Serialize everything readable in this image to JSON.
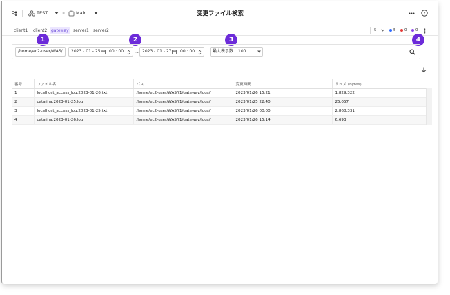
{
  "topbar": {
    "workspace": "TEST",
    "project": "Main",
    "title": "変更ファイル検索"
  },
  "tabs": [
    {
      "label": "client1",
      "active": false
    },
    {
      "label": "client2",
      "active": false
    },
    {
      "label": "gateway",
      "active": true
    },
    {
      "label": "server1",
      "active": false
    },
    {
      "label": "server2",
      "active": false
    }
  ],
  "status": {
    "count": "5",
    "blue": "5",
    "red": "0",
    "purple": "0",
    "colors": {
      "blue": "#2f6bff",
      "red": "#e53935",
      "purple": "#8e44ec"
    }
  },
  "filter": {
    "path": "/home/ec2-user/WAS/t",
    "from_date": "2023 - 01 - 25",
    "from_time": "00 : 00",
    "range_sep": "~",
    "to_date": "2023 - 01 - 27",
    "to_time": "00 : 00",
    "max_label": "最大表示数",
    "max_value": "100"
  },
  "badges": [
    "1",
    "2",
    "3",
    "4"
  ],
  "table": {
    "headers": [
      "番号",
      "ファイル名",
      "パス",
      "変更時間",
      "サイズ (bytes)"
    ],
    "rows": [
      [
        "1",
        "localhost_access_log.2023-01-26.txt",
        "/home/ec2-user/WAS/t1/gateway/logs/",
        "2023/01/26 15:21",
        "1,829,322"
      ],
      [
        "2",
        "catalina.2023-01-25.log",
        "/home/ec2-user/WAS/t1/gateway/logs/",
        "2023/01/25 22:40",
        "25,057"
      ],
      [
        "3",
        "localhost_access_log.2023-01-25.txt",
        "/home/ec2-user/WAS/t1/gateway/logs/",
        "2023/01/26 00:00",
        "2,868,331"
      ],
      [
        "4",
        "catalina.2023-01-26.log",
        "/home/ec2-user/WAS/t1/gateway/logs/",
        "2023/01/26 15:14",
        "6,693"
      ]
    ]
  },
  "accent": "#6c2bd9"
}
